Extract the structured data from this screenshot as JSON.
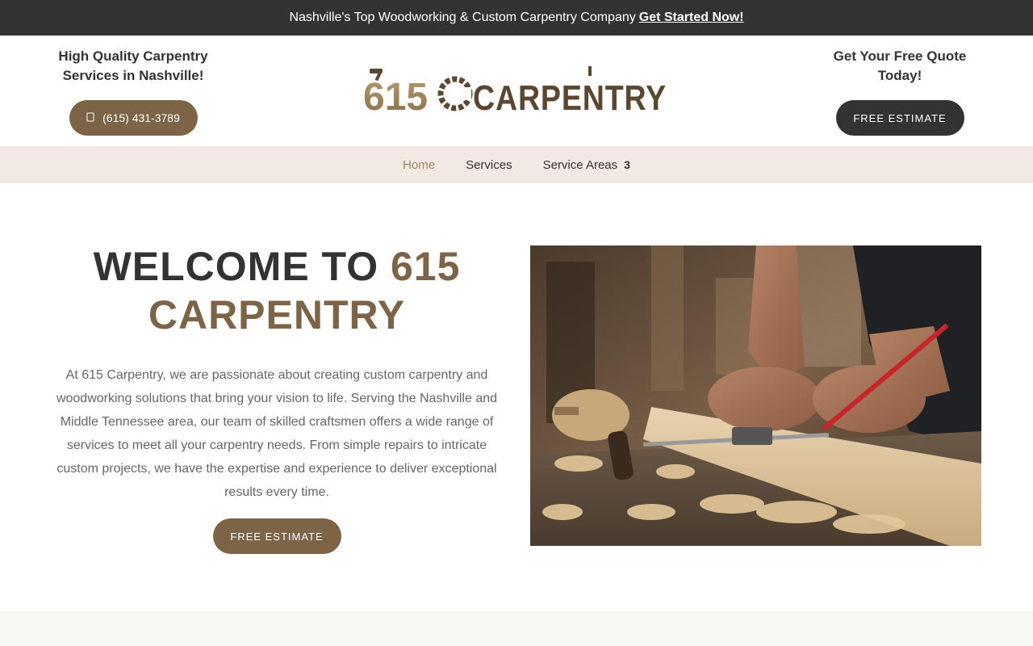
{
  "topbar": {
    "text": "Nashville's Top Woodworking & Custom Carpentry Company",
    "link": "Get Started Now!"
  },
  "header": {
    "left_tagline_line1": "High Quality Carpentry",
    "left_tagline_line2": "Services in Nashville!",
    "phone_icon": "phone-icon",
    "phone": "(615) 431-3789",
    "logo_num": "615",
    "logo_word": "CARPENTRY",
    "right_tagline_line1": "Get Your Free Quote",
    "right_tagline_line2": "Today!",
    "estimate_button": "FREE ESTIMATE"
  },
  "nav": {
    "items": [
      {
        "label": "Home",
        "active": true
      },
      {
        "label": "Services"
      },
      {
        "label": "Service Areas",
        "caret": "3"
      }
    ]
  },
  "hero": {
    "title_part1": "WELCOME TO ",
    "title_accent_inline": "615",
    "title_accent_line2": "CARPENTRY",
    "paragraph": "At 615 Carpentry, we are passionate about creating custom carpentry and woodworking solutions that bring your vision to life. Serving the Nashville and Middle Tennessee area, our team of skilled craftsmen offers a wide range of services to meet all your carpentry needs. From simple repairs to intricate custom projects, we have the expertise and experience to deliver exceptional results every time.",
    "button": "FREE ESTIMATE"
  },
  "colors": {
    "brand_brown": "#7d6447",
    "dark": "#333333",
    "nav_bg": "#f1e9e2",
    "nav_active": "#a08462"
  }
}
